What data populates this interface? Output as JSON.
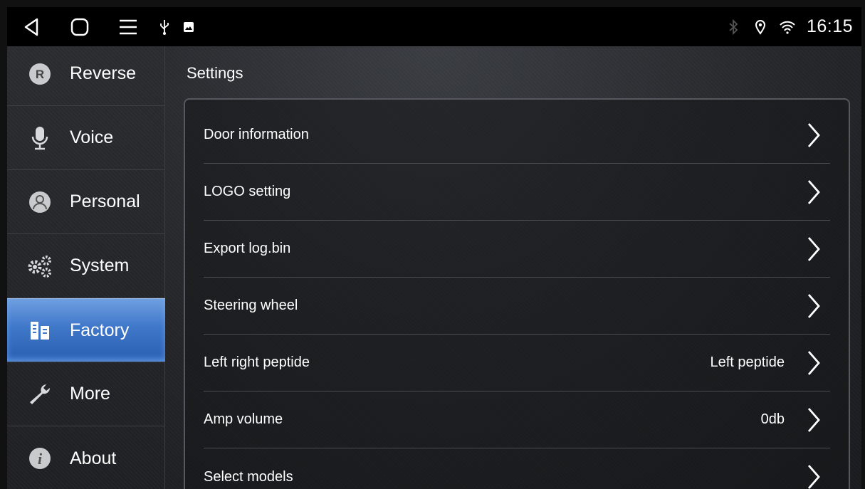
{
  "status_bar": {
    "time": "16:15",
    "icons": [
      "back-icon",
      "home-icon",
      "menu-icon",
      "usb-icon",
      "gallery-icon",
      "bluetooth-icon",
      "location-icon",
      "wifi-icon"
    ]
  },
  "sidebar": {
    "items": [
      {
        "label": "Reverse",
        "icon": "reverse-icon"
      },
      {
        "label": "Voice",
        "icon": "microphone-icon"
      },
      {
        "label": "Personal",
        "icon": "person-icon"
      },
      {
        "label": "System",
        "icon": "gears-icon"
      },
      {
        "label": "Factory",
        "icon": "factory-icon",
        "active": true
      },
      {
        "label": "More",
        "icon": "wrench-icon"
      },
      {
        "label": "About",
        "icon": "info-icon"
      }
    ]
  },
  "main": {
    "title": "Settings",
    "rows": [
      {
        "label": "Door information",
        "value": ""
      },
      {
        "label": "LOGO setting",
        "value": ""
      },
      {
        "label": "Export log.bin",
        "value": ""
      },
      {
        "label": "Steering wheel",
        "value": ""
      },
      {
        "label": "Left right peptide",
        "value": "Left peptide"
      },
      {
        "label": "Amp volume",
        "value": "0db"
      },
      {
        "label": "Select models",
        "value": ""
      }
    ]
  },
  "colors": {
    "accent": "#3f77c9",
    "background": "#26282c",
    "statusbar": "#000000"
  }
}
